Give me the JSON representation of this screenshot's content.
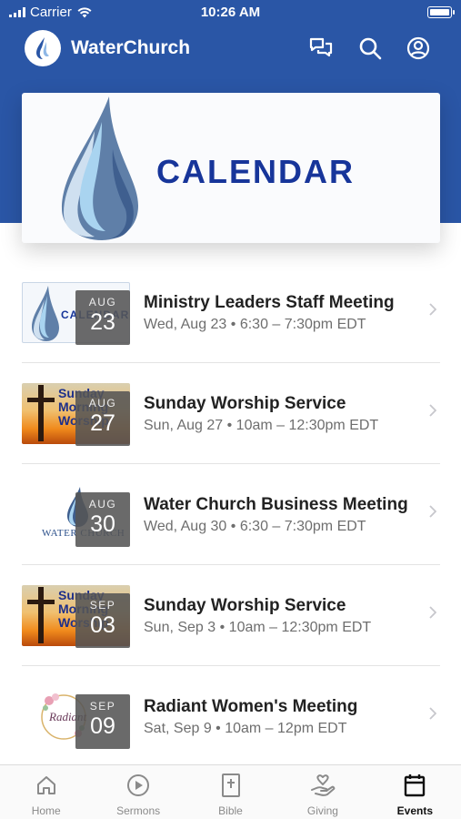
{
  "status_bar": {
    "carrier": "Carrier",
    "time": "10:26 AM"
  },
  "header": {
    "app_title": "WaterChurch",
    "icons": [
      "chat-icon",
      "search-icon",
      "profile-icon"
    ]
  },
  "banner": {
    "text": "CALENDAR"
  },
  "events": [
    {
      "title": "Ministry Leaders Staff Meeting",
      "time": "Wed, Aug 23 • 6:30 – 7:30pm EDT",
      "month": "AUG",
      "day": "23",
      "thumb": {
        "type": "calendar",
        "text": "CALENDAR"
      }
    },
    {
      "title": "Sunday Worship Service",
      "time": "Sun, Aug 27 • 10am – 12:30pm EDT",
      "month": "AUG",
      "day": "27",
      "thumb": {
        "type": "sunday",
        "lines": [
          "Sunday",
          "Morning",
          "Worship"
        ]
      }
    },
    {
      "title": "Water Church Business Meeting",
      "time": "Wed, Aug 30 • 6:30 – 7:30pm EDT",
      "month": "AUG",
      "day": "30",
      "thumb": {
        "type": "logo",
        "text": "WATER CHURCH"
      }
    },
    {
      "title": "Sunday Worship Service",
      "time": "Sun, Sep 3 • 10am – 12:30pm EDT",
      "month": "SEP",
      "day": "03",
      "thumb": {
        "type": "sunday",
        "lines": [
          "Sunday",
          "Morning",
          "Worship"
        ]
      }
    },
    {
      "title": "Radiant Women's Meeting",
      "time": "Sat, Sep 9 • 10am – 12pm EDT",
      "month": "SEP",
      "day": "09",
      "thumb": {
        "type": "radiant",
        "text": "Radiant"
      }
    }
  ],
  "tabbar": [
    {
      "label": "Home",
      "icon": "home-icon",
      "active": false
    },
    {
      "label": "Sermons",
      "icon": "play-circle-icon",
      "active": false
    },
    {
      "label": "Bible",
      "icon": "bible-icon",
      "active": false
    },
    {
      "label": "Giving",
      "icon": "giving-hand-icon",
      "active": false
    },
    {
      "label": "Events",
      "icon": "calendar-icon",
      "active": true
    }
  ],
  "colors": {
    "brand_blue": "#2a56a6",
    "calendar_text": "#17359a",
    "badge_gray": "#555555"
  }
}
